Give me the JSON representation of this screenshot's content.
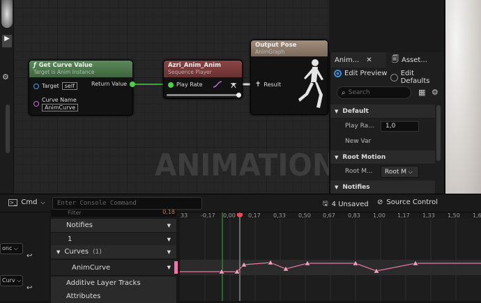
{
  "graph": {
    "watermark": "ANIMATION",
    "node_getcurve": {
      "title": "Get Curve Value",
      "subtitle": "Target is Anim Instance",
      "target_label": "Target",
      "target_value": "self",
      "return_label": "Return Value",
      "curve_label": "Curve Name",
      "curve_value": "AnimCurve",
      "func_glyph": "ƒ"
    },
    "node_seqplayer": {
      "title": "Azri_Anim_Anim",
      "subtitle": "Sequence Player",
      "play_rate_label": "Play Rate"
    },
    "node_output": {
      "title": "Output Pose",
      "subtitle": "AnimGraph",
      "result_label": "Result"
    },
    "colors": {
      "green_head": "#4d7a4d",
      "red_head": "#7a3b3b",
      "tan_head": "#8c7a6a",
      "float_pin": "#44d444",
      "name_pin": "#c46ad6",
      "exec_pin": "#cccccc"
    }
  },
  "details": {
    "tabs": [
      "Anim...",
      "Asset..."
    ],
    "radio_edit_preview": "Edit Preview",
    "radio_edit_defaults": "Edit Defaults",
    "search_placeholder": "Search",
    "section_default": "Default",
    "play_rate_label": "Play Ra...",
    "play_rate_value": "1,0",
    "new_var_label": "New Var",
    "section_root_motion": "Root Motion",
    "root_motion_label": "Root M...",
    "root_motion_value": "Root M",
    "section_notifies": "Notifies"
  },
  "toolbar": {
    "cmd_label": "Cmd",
    "console_placeholder": "Enter Console Command",
    "unsaved": "4 Unsaved",
    "source_control": "Source Control"
  },
  "timeline": {
    "filter_value": "Filter",
    "filter_right": "0,18",
    "tracks": [
      {
        "label": "Notifies"
      },
      {
        "label": "1"
      },
      {
        "label": "Curves",
        "count": "(1)"
      },
      {
        "label": "AnimCurve"
      },
      {
        "label": "Additive Layer Tracks"
      },
      {
        "label": "Attributes"
      }
    ],
    "ticks": [
      "33",
      "-0,17",
      "0,00",
      "0,17",
      "0,33",
      "0,50",
      "0,67",
      "0,83",
      "1,00",
      "1,17",
      "1,33",
      "1,50",
      "1,6"
    ],
    "left_dd1": "onc",
    "left_dd2": "Curv"
  }
}
